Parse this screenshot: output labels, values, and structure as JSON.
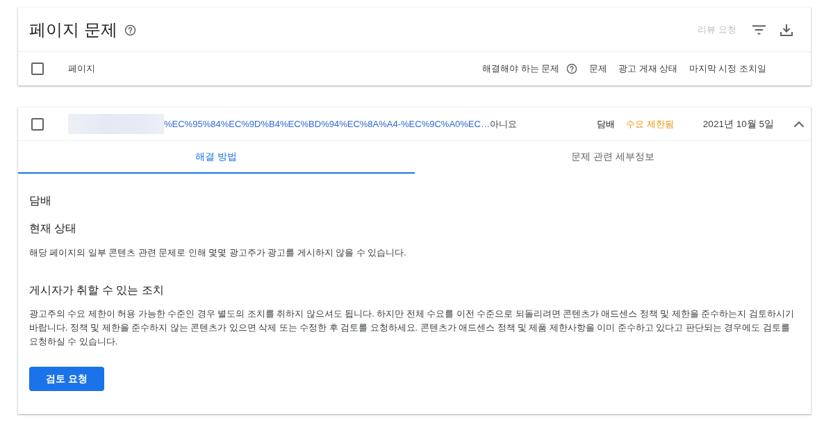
{
  "header": {
    "title": "페이지 문제",
    "review_button": {
      "label": "리뷰 요청",
      "disabled": true
    }
  },
  "table": {
    "select_all": {
      "checked": false
    },
    "columns": [
      {
        "label": "페이지",
        "help": false
      },
      {
        "label": "해결해야 하는 문제",
        "help": true
      },
      {
        "label": "문제",
        "help": false
      },
      {
        "label": "광고 게재 상태",
        "help": false
      },
      {
        "label": "마지막 시정 조치일",
        "help": false
      }
    ]
  },
  "rows": [
    {
      "checked": false,
      "page_link": "%EC%95%84%EC%9D%B4%EC%BD%94%EC%8A%A4-%EC%9C%A0%EC…",
      "must_fix": "아니요",
      "issue": "담배",
      "status": {
        "label": "수요 제한됨",
        "color": "#e8930c"
      },
      "last_action_date": "2021년 10월 5일",
      "expanded": true,
      "tabs": [
        {
          "label": "해결 방법",
          "selected": true
        },
        {
          "label": "문제 관련 세부정보",
          "selected": false
        }
      ],
      "detail": {
        "category": "담배",
        "sections": [
          {
            "heading": "현재 상태",
            "text": "해당 페이지의 일부 콘텐츠 관련 문제로 인해 몇몇 광고주가 광고를 게시하지 않을 수 있습니다."
          },
          {
            "heading": "게시자가 취할 수 있는 조치",
            "text": "광고주의 수요 제한이 허용 가능한 수준인 경우 별도의 조치를 취하지 않으셔도 됩니다. 하지만 전체 수요를 이전 수준으로 되돌리려면 콘텐츠가 애드센스 정책 및 제한을 준수하는지 검토하시기 바랍니다. 정책 및 제한을 준수하지 않는 콘텐츠가 있으면 삭제 또는 수정한 후 검토를 요청하세요. 콘텐츠가 애드센스 정책 및 제품 제한사항을 이미 준수하고 있다고 판단되는 경우에도 검토를 요청하실 수 있습니다."
          }
        ],
        "action_button": "검토 요청"
      }
    }
  ]
}
